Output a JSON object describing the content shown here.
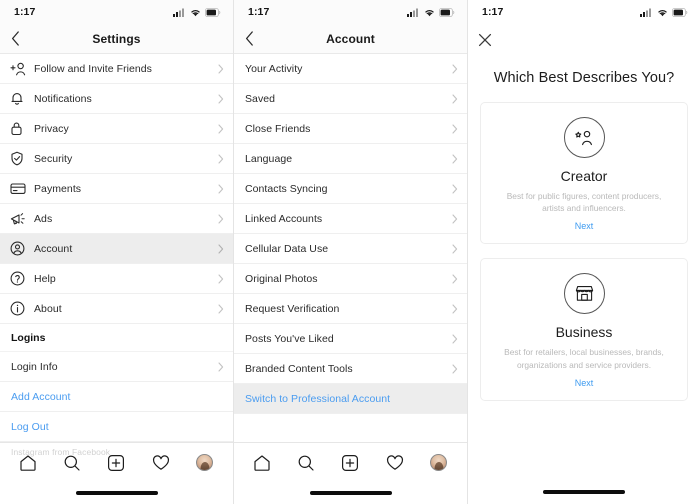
{
  "status_bar": {
    "time": "1:17",
    "signal_icon": "cellular-signal-icon",
    "wifi_icon": "wifi-icon",
    "battery_icon": "battery-icon"
  },
  "panel_settings": {
    "nav": {
      "back_icon": "chevron-left-icon",
      "title": "Settings"
    },
    "items": [
      {
        "icon": "add-person-icon",
        "label": "Follow and Invite Friends",
        "selected": false
      },
      {
        "icon": "bell-icon",
        "label": "Notifications",
        "selected": false
      },
      {
        "icon": "lock-icon",
        "label": "Privacy",
        "selected": false
      },
      {
        "icon": "shield-check-icon",
        "label": "Security",
        "selected": false
      },
      {
        "icon": "credit-card-icon",
        "label": "Payments",
        "selected": false
      },
      {
        "icon": "megaphone-icon",
        "label": "Ads",
        "selected": false
      },
      {
        "icon": "account-circle-icon",
        "label": "Account",
        "selected": true
      },
      {
        "icon": "question-circle-icon",
        "label": "Help",
        "selected": false
      },
      {
        "icon": "info-circle-icon",
        "label": "About",
        "selected": false
      }
    ],
    "section_logins": "Logins",
    "login_info": "Login Info",
    "add_account": "Add Account",
    "log_out": "Log Out",
    "footnote": "Instagram from Facebook"
  },
  "panel_account": {
    "nav": {
      "back_icon": "chevron-left-icon",
      "title": "Account"
    },
    "items": [
      {
        "label": "Your Activity",
        "link": false
      },
      {
        "label": "Saved",
        "link": false
      },
      {
        "label": "Close Friends",
        "link": false
      },
      {
        "label": "Language",
        "link": false
      },
      {
        "label": "Contacts Syncing",
        "link": false
      },
      {
        "label": "Linked Accounts",
        "link": false
      },
      {
        "label": "Cellular Data Use",
        "link": false
      },
      {
        "label": "Original Photos",
        "link": false
      },
      {
        "label": "Request Verification",
        "link": false
      },
      {
        "label": "Posts You've Liked",
        "link": false
      },
      {
        "label": "Branded Content Tools",
        "link": false
      }
    ],
    "switch_professional": "Switch to Professional Account"
  },
  "panel_describe": {
    "close_icon": "close-x-icon",
    "title": "Which Best Describes You?",
    "cards": [
      {
        "icon": "creator-star-person-icon",
        "title": "Creator",
        "desc": "Best for public figures, content producers, artists and influencers.",
        "next": "Next"
      },
      {
        "icon": "storefront-icon",
        "title": "Business",
        "desc": "Best for retailers, local businesses, brands, organizations and service providers.",
        "next": "Next"
      }
    ]
  },
  "tabbar": {
    "items": [
      {
        "icon": "home-icon",
        "name": "tab-home"
      },
      {
        "icon": "search-icon",
        "name": "tab-search"
      },
      {
        "icon": "add-post-icon",
        "name": "tab-create"
      },
      {
        "icon": "heart-icon",
        "name": "tab-activity"
      },
      {
        "icon": "avatar-icon",
        "name": "tab-profile"
      }
    ]
  },
  "colors": {
    "link_blue": "#4a9cf0",
    "selected_row": "#ededed",
    "text": "#2a2a2a",
    "muted": "#b9b9b9"
  }
}
